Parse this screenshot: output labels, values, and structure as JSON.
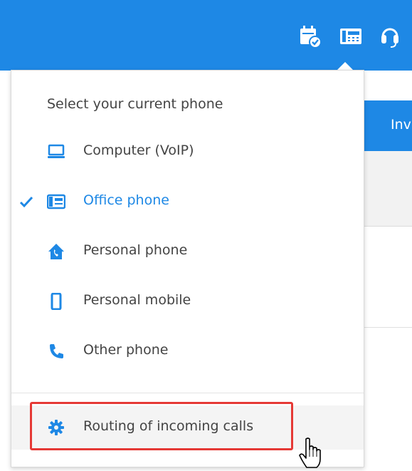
{
  "background": {
    "blue_row_text": "Inv"
  },
  "topbar": {
    "icons": [
      "calendar-check-icon",
      "office-phone-icon",
      "headset-icon"
    ]
  },
  "dropdown": {
    "header": "Select your current phone",
    "items": [
      {
        "label": "Computer (VoIP)",
        "icon": "computer-icon",
        "selected": false
      },
      {
        "label": "Office phone",
        "icon": "office-phone-icon",
        "selected": true
      },
      {
        "label": "Personal phone",
        "icon": "house-phone-icon",
        "selected": false
      },
      {
        "label": "Personal mobile",
        "icon": "mobile-icon",
        "selected": false
      },
      {
        "label": "Other phone",
        "icon": "phone-handset-icon",
        "selected": false
      }
    ],
    "routing_label": "Routing of incoming calls"
  },
  "colors": {
    "accent": "#1e88e5",
    "text": "#444444",
    "highlight": "#e53935"
  }
}
